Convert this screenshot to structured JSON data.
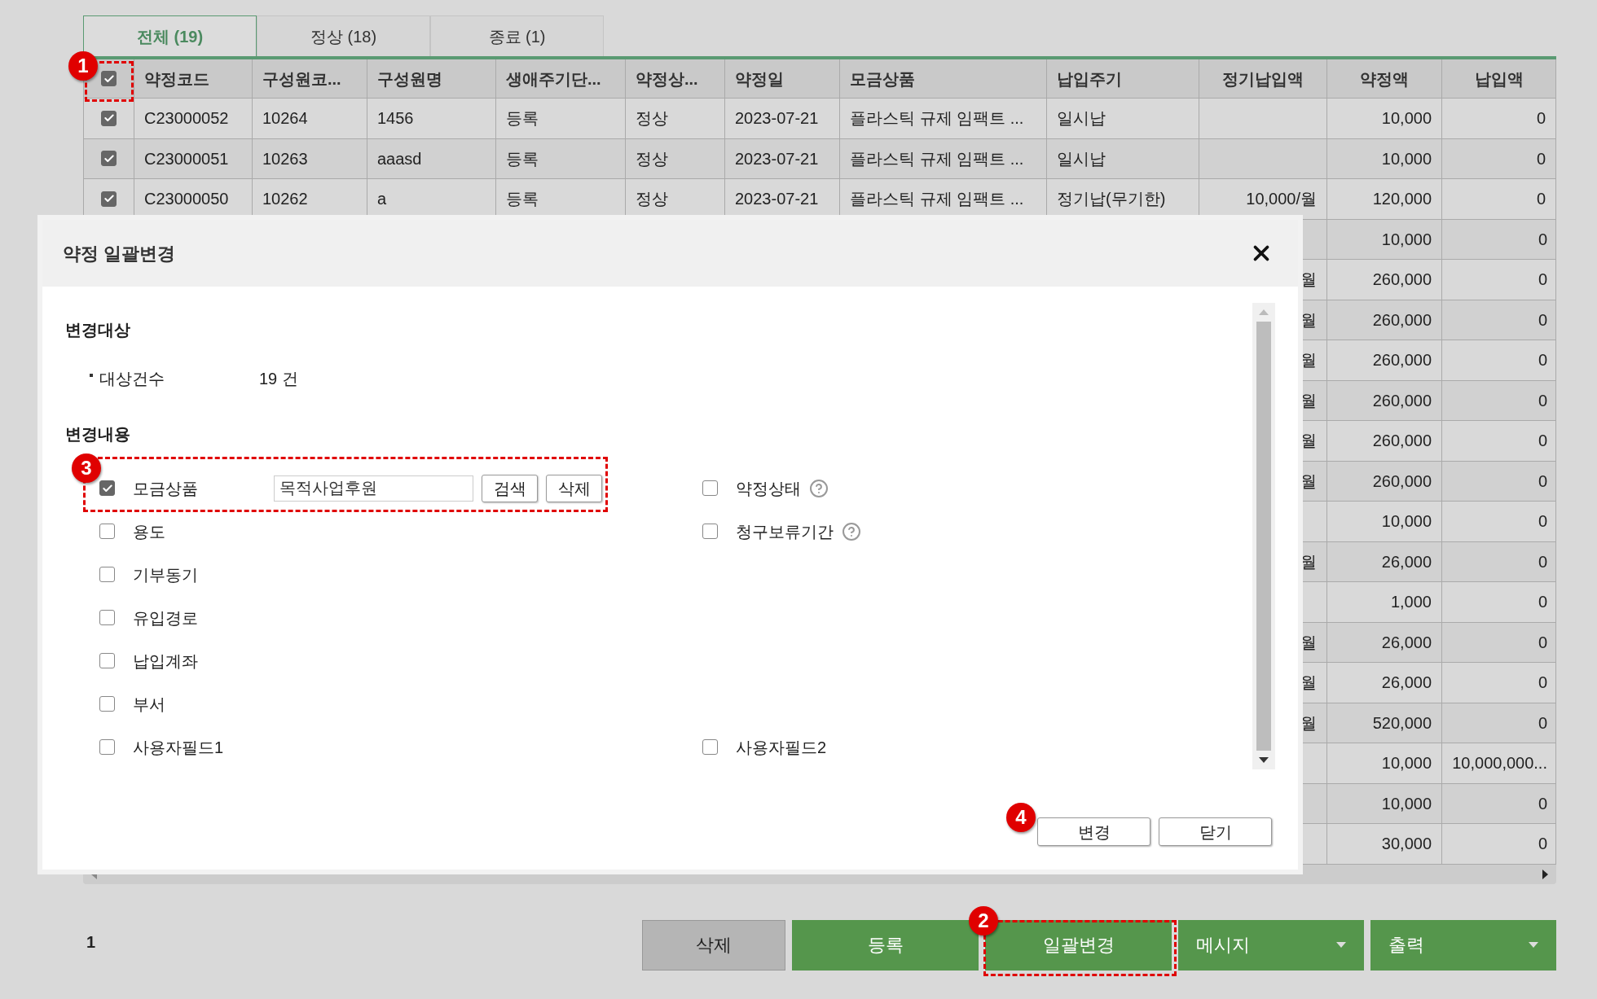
{
  "tabs": [
    {
      "label": "전체 (19)",
      "selected": true
    },
    {
      "label": "정상 (18)",
      "selected": false
    },
    {
      "label": "종료 (1)",
      "selected": false
    }
  ],
  "table": {
    "header_checked": true,
    "columns": [
      "약정코드",
      "구성원코...",
      "구성원명",
      "생애주기단...",
      "약정상...",
      "약정일",
      "모금상품",
      "납입주기",
      "정기납입액",
      "약정액",
      "납입액"
    ],
    "rows": [
      {
        "checked": true,
        "cells": [
          "C23000052",
          "10264",
          "1456",
          "등록",
          "정상",
          "2023-07-21",
          "플라스틱 규제 임팩트 ...",
          "일시납",
          "",
          "10,000",
          "0"
        ]
      },
      {
        "checked": true,
        "cells": [
          "C23000051",
          "10263",
          "aaasd",
          "등록",
          "정상",
          "2023-07-21",
          "플라스틱 규제 임팩트 ...",
          "일시납",
          "",
          "10,000",
          "0"
        ]
      },
      {
        "checked": true,
        "cells": [
          "C23000050",
          "10262",
          "a",
          "등록",
          "정상",
          "2023-07-21",
          "플라스틱 규제 임팩트 ...",
          "정기납(무기한)",
          "10,000/월",
          "120,000",
          "0"
        ]
      }
    ],
    "covered_rows": [
      {
        "regular_amount_tail": "",
        "pledge_amount": "10,000",
        "paid_amount": "0"
      },
      {
        "regular_amount_tail": "월",
        "pledge_amount": "260,000",
        "paid_amount": "0"
      },
      {
        "regular_amount_tail": "월",
        "pledge_amount": "260,000",
        "paid_amount": "0"
      },
      {
        "regular_amount_tail": "월",
        "pledge_amount": "260,000",
        "paid_amount": "0"
      },
      {
        "regular_amount_tail": "월",
        "pledge_amount": "260,000",
        "paid_amount": "0"
      },
      {
        "regular_amount_tail": "월",
        "pledge_amount": "260,000",
        "paid_amount": "0"
      },
      {
        "regular_amount_tail": "월",
        "pledge_amount": "260,000",
        "paid_amount": "0"
      },
      {
        "regular_amount_tail": "",
        "pledge_amount": "10,000",
        "paid_amount": "0"
      },
      {
        "regular_amount_tail": "월",
        "pledge_amount": "26,000",
        "paid_amount": "0"
      },
      {
        "regular_amount_tail": "",
        "pledge_amount": "1,000",
        "paid_amount": "0"
      },
      {
        "regular_amount_tail": "월",
        "pledge_amount": "26,000",
        "paid_amount": "0"
      },
      {
        "regular_amount_tail": "월",
        "pledge_amount": "26,000",
        "paid_amount": "0"
      },
      {
        "regular_amount_tail": "월",
        "pledge_amount": "520,000",
        "paid_amount": "0"
      },
      {
        "regular_amount_tail": "",
        "pledge_amount": "10,000",
        "paid_amount": "10,000,000..."
      },
      {
        "regular_amount_tail": "",
        "pledge_amount": "10,000",
        "paid_amount": "0"
      },
      {
        "regular_amount_tail": "",
        "pledge_amount": "30,000",
        "paid_amount": "0"
      }
    ]
  },
  "dialog": {
    "title": "약정 일괄변경",
    "target_heading": "변경대상",
    "target_label": "대상건수",
    "target_value": "19 건",
    "change_heading": "변경내용",
    "options": [
      {
        "left": {
          "kind": "picker",
          "label": "모금상품",
          "checked": true,
          "value": "목적사업후원",
          "buttons": [
            "검색",
            "삭제"
          ]
        },
        "right": {
          "label": "약정상태",
          "checked": false,
          "help": true
        }
      },
      {
        "left": {
          "kind": "checkbox",
          "label": "용도",
          "checked": false
        },
        "right": {
          "label": "청구보류기간",
          "checked": false,
          "help": true
        }
      },
      {
        "left": {
          "kind": "checkbox",
          "label": "기부동기",
          "checked": false
        }
      },
      {
        "left": {
          "kind": "checkbox",
          "label": "유입경로",
          "checked": false
        }
      },
      {
        "left": {
          "kind": "checkbox",
          "label": "납입계좌",
          "checked": false
        }
      },
      {
        "left": {
          "kind": "checkbox",
          "label": "부서",
          "checked": false
        }
      },
      {
        "left": {
          "kind": "checkbox",
          "label": "사용자필드1",
          "checked": false
        },
        "right": {
          "label": "사용자필드2",
          "checked": false,
          "help": false
        }
      }
    ],
    "buttons": [
      "변경",
      "닫기"
    ]
  },
  "page_number": "1",
  "actions": [
    {
      "label": "삭제",
      "kind": "gray"
    },
    {
      "label": "등록",
      "kind": "green"
    },
    {
      "label": "일괄변경",
      "kind": "green"
    },
    {
      "label": "메시지",
      "kind": "dropdown"
    },
    {
      "label": "출력",
      "kind": "dropdown"
    }
  ],
  "markers": [
    "1",
    "2",
    "3",
    "4"
  ]
}
